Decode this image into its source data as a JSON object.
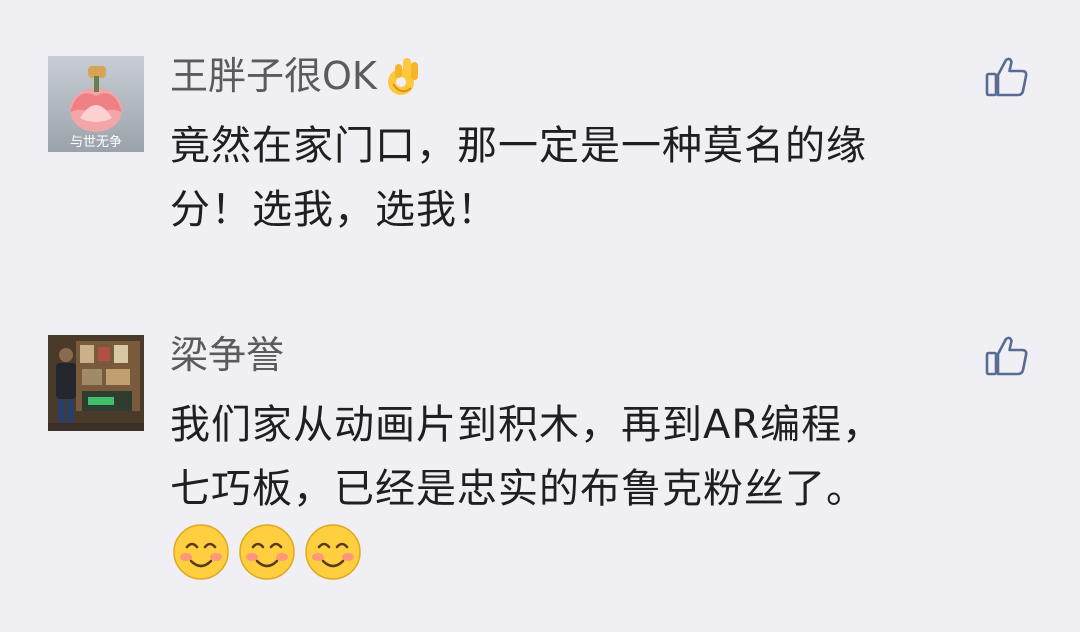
{
  "comments": [
    {
      "author": "王胖子很OK",
      "author_emoji": "ok-hand",
      "avatar_caption": "与世无争",
      "text_lines": [
        "竟然在家门口，那一定是一种莫名的缘",
        "分！选我，选我！"
      ]
    },
    {
      "author": "梁争誉",
      "text_lines": [
        "我们家从动画片到积木，再到AR编程，",
        "七巧板，已经是忠实的布鲁克粉丝了。"
      ],
      "emojis": [
        "smiling-face-with-blush",
        "smiling-face-with-blush",
        "smiling-face-with-blush"
      ]
    }
  ],
  "colors": {
    "background": "#efeff4",
    "author_text": "#5b5b5b",
    "body_text": "#1f1f1f",
    "like_icon": "#576b95"
  }
}
